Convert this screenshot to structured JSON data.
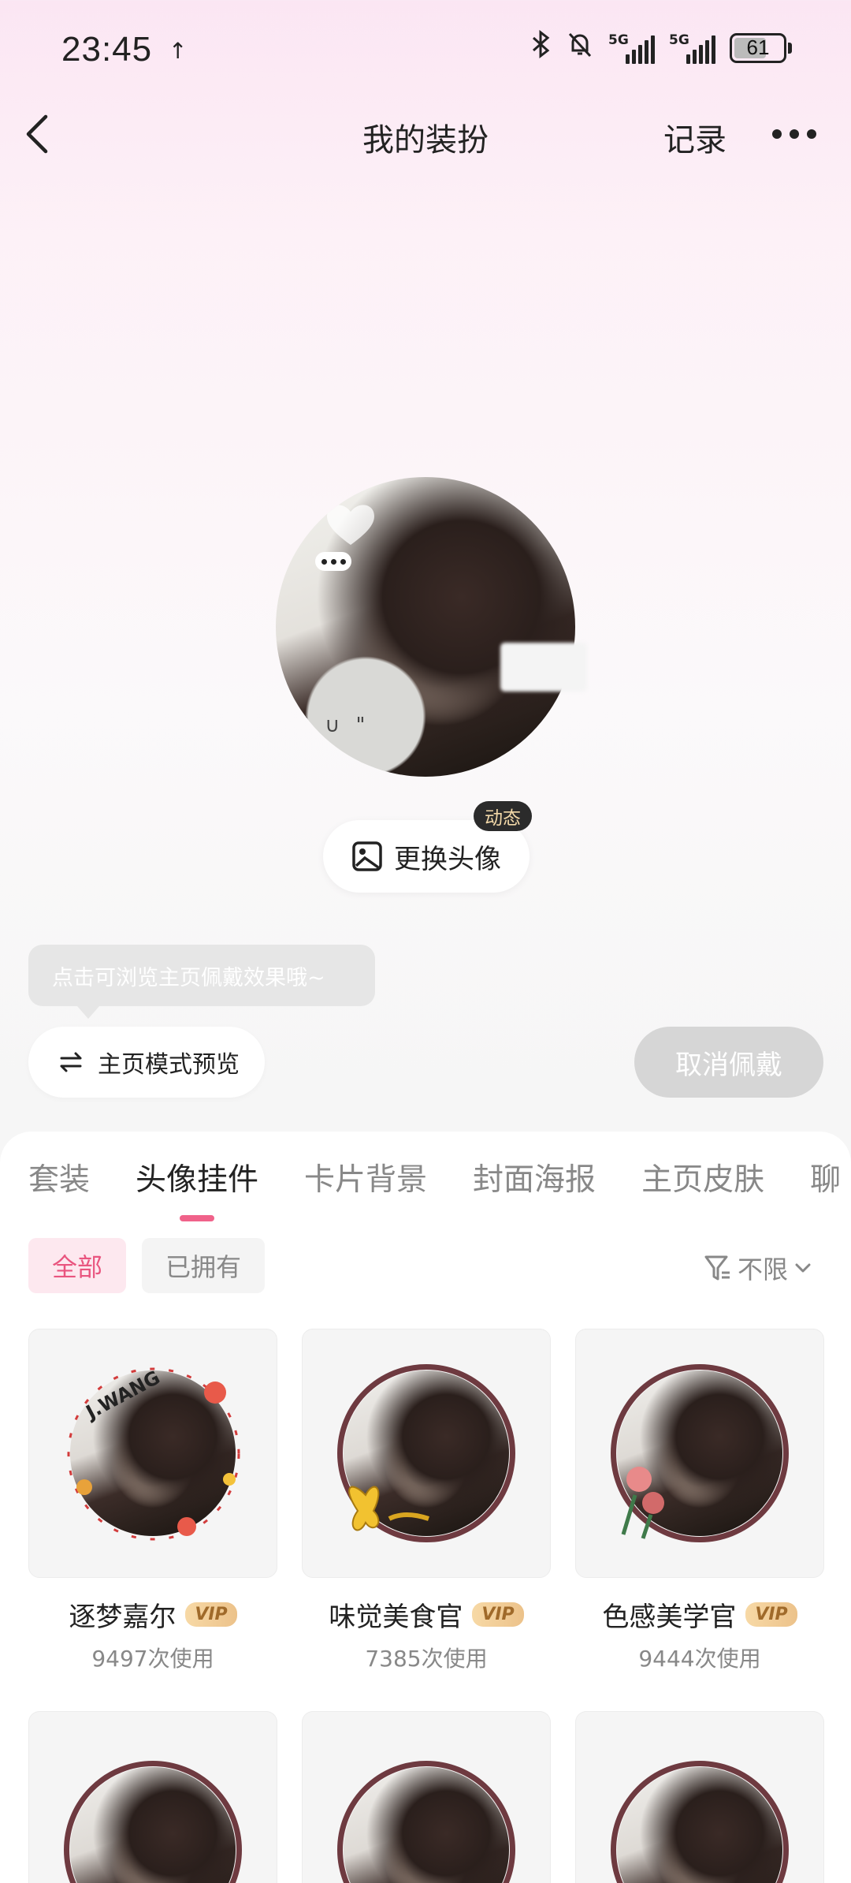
{
  "status_bar": {
    "time": "23:45",
    "battery": "61",
    "network_1": "5G",
    "network_2": "5G"
  },
  "nav": {
    "title": "我的装扮",
    "record": "记录"
  },
  "avatar": {
    "face_text": "\" ∪ \""
  },
  "change_avatar": {
    "label": "更换头像",
    "badge": "动态"
  },
  "tooltip": {
    "text": "点击可浏览主页佩戴效果哦~"
  },
  "preview": {
    "label": "主页模式预览"
  },
  "cancel": {
    "label": "取消佩戴"
  },
  "tabs": [
    "套装",
    "头像挂件",
    "卡片背景",
    "封面海报",
    "主页皮肤",
    "聊"
  ],
  "filters": {
    "all": "全部",
    "owned": "已拥有",
    "sort": "不限"
  },
  "items": [
    {
      "name": "逐梦嘉尔",
      "vip": "VIP",
      "usage": "9497次使用",
      "frame_text": "J.WANG"
    },
    {
      "name": "味觉美食官",
      "vip": "VIP",
      "usage": "7385次使用"
    },
    {
      "name": "色感美学官",
      "vip": "VIP",
      "usage": "9444次使用"
    }
  ],
  "colors": {
    "accent": "#f0628a",
    "chip_active_bg": "#fde8ef",
    "vip_gold": "#ecc28a",
    "frame_ring": "#6e3a40"
  }
}
